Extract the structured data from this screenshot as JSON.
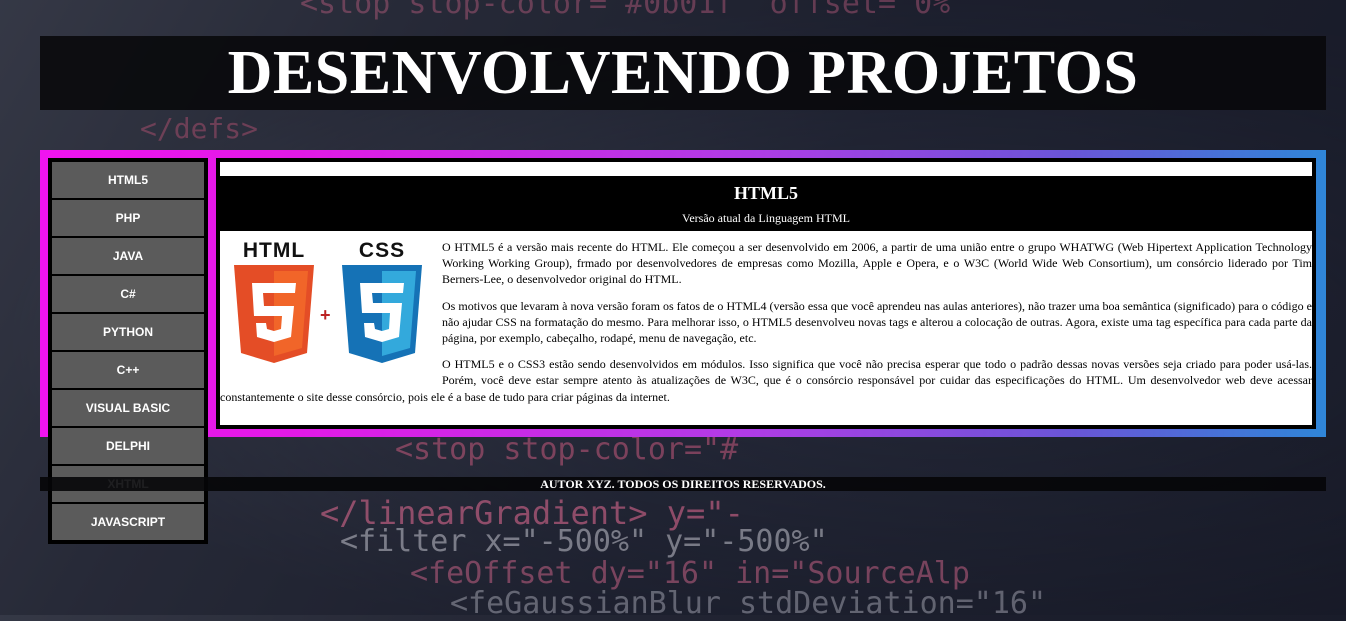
{
  "header": {
    "title": "DESENVOLVENDO PROJETOS"
  },
  "menu": {
    "items": [
      {
        "label": "HTML5"
      },
      {
        "label": "PHP"
      },
      {
        "label": "JAVA"
      },
      {
        "label": "C#"
      },
      {
        "label": "PYTHON"
      },
      {
        "label": "C++"
      },
      {
        "label": "VISUAL BASIC"
      },
      {
        "label": "DELPHI"
      },
      {
        "label": "XHTML"
      },
      {
        "label": "JAVASCRIPT"
      }
    ]
  },
  "article": {
    "title": "HTML5",
    "subtitle": "Versão atual da Linguagem HTML",
    "logo_html_text": "HTML",
    "logo_css_text": "CSS",
    "paragraphs": [
      "O HTML5 é a versão mais recente do HTML. Ele começou a ser desenvolvido em 2006, a partir de uma união entre o grupo WHATWG (Web Hipertext Application Technology Working Working Group), frmado por desenvolvedores de empresas como Mozilla, Apple e Opera, e o W3C (World Wide Web Consortium), um consórcio liderado por Tim Berners-Lee, o desenvolvedor original do HTML.",
      "Os motivos que levaram à nova versão foram os fatos de o HTML4 (versão essa que você aprendeu nas aulas anteriores), não trazer uma boa semântica (significado) para o código e não ajudar CSS na formatação do mesmo. Para melhorar isso, o HTML5 desenvolveu novas tags e alterou a colocação de outras. Agora, existe uma tag específica para cada parte da página, por exemplo, cabeçalho, rodapé, menu de navegação, etc.",
      "O HTML5 e o CSS3 estão sendo desenvolvidos em módulos. Isso significa que você não precisa esperar que todo o padrão dessas novas versões seja criado para poder usá-las. Porém, você deve estar sempre atento às atualizações de W3C, que é o consórcio responsável por cuidar das especificações do HTML. Um desenvolvedor web deve acessar constantemente o site desse consórcio, pois ele é a base de tudo para criar páginas da internet."
    ]
  },
  "footer": {
    "text": "AUTOR XYZ. TODOS OS DIREITOS RESERVADOS."
  },
  "background": {
    "code_lines": [
      "<stop stop-color=\"#0b01f\" offset=\"0%\"",
      "</defs>",
      "<stop stop-color=\"#",
      "</linearGradient> y=\"-",
      "<filter x=\"-500%\" y=\"-500%\"",
      "<feOffset dy=\"16\" in=\"SourceAlp",
      "<feGaussianBlur stdDeviation=\"16\""
    ]
  },
  "colors": {
    "panel_gradient_start": "#f014f0",
    "panel_gradient_end": "#2f86d8",
    "menu_item_bg": "#5b5b5b",
    "html5_orange": "#e44d26",
    "css3_blue": "#1572b6"
  }
}
